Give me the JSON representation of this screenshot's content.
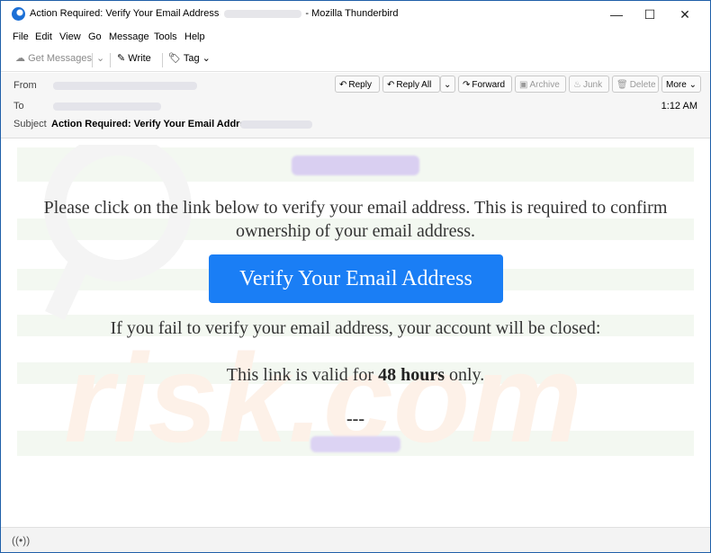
{
  "window": {
    "title": "Action Required: Verify Your Email Address",
    "app_name": "- Mozilla Thunderbird",
    "minimize": "—",
    "maximize": "☐",
    "close": "✕"
  },
  "menu": [
    "File",
    "Edit",
    "View",
    "Go",
    "Message",
    "Tools",
    "Help"
  ],
  "toolbar": {
    "get_messages": "Get Messages",
    "write": "Write",
    "tag": "Tag"
  },
  "header": {
    "from_label": "From",
    "to_label": "To",
    "subject_label": "Subject",
    "subject": "Action Required: Verify Your Email Address",
    "time": "1:12 AM",
    "buttons": {
      "reply": "Reply",
      "reply_all": "Reply All",
      "forward": "Forward",
      "archive": "Archive",
      "junk": "Junk",
      "delete": "Delete",
      "more": "More"
    }
  },
  "body": {
    "paragraph1": "Please click on the link below to verify your email address. This is required to confirm ownership of your email address.",
    "button": "Verify Your Email Address",
    "paragraph2": "If you fail to verify your email address, your account will be closed:",
    "p3_before": "This link is valid for ",
    "p3_bold": "48 hours",
    "p3_after": " only.",
    "dashes": "---"
  },
  "icons": {
    "app": "thunderbird-icon",
    "status": "radio-waves-icon"
  },
  "colors": {
    "accent": "#1a7ef5",
    "stripe": "#f3f8f1",
    "redacted": "#d9cff1"
  }
}
